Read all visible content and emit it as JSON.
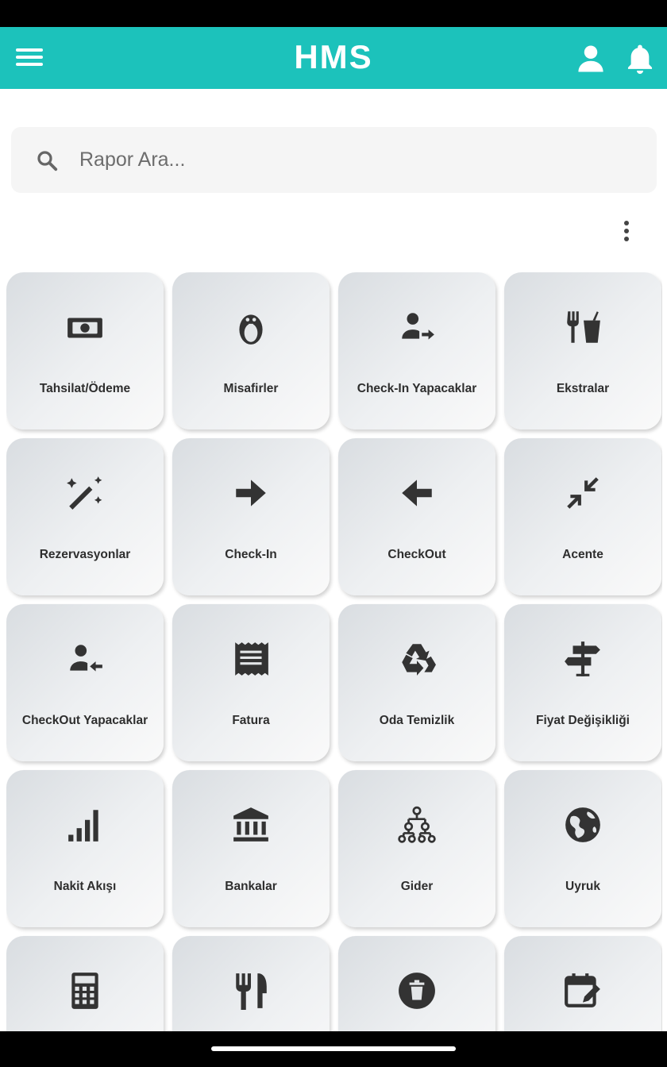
{
  "app": {
    "title": "HMS",
    "brand_color": "#1cc2bb"
  },
  "header": {
    "menu_icon": "hamburger-menu-icon",
    "user_icon": "person-icon",
    "bell_icon": "notifications-bell-icon"
  },
  "search": {
    "placeholder": "Rapor Ara...",
    "value": "",
    "icon": "search-icon"
  },
  "options_icon": "more-vert-icon",
  "tiles": [
    {
      "label": "Tahsilat/Ödeme",
      "icon": "money-bill-icon"
    },
    {
      "label": "Misafirler",
      "icon": "penguin-icon"
    },
    {
      "label": "Check-In Yapacaklar",
      "icon": "person-arrow-right-icon"
    },
    {
      "label": "Ekstralar",
      "icon": "fork-drink-icon"
    },
    {
      "label": "Rezervasyonlar",
      "icon": "magic-wand-icon"
    },
    {
      "label": "Check-In",
      "icon": "arrow-right-icon"
    },
    {
      "label": "CheckOut",
      "icon": "arrow-left-icon"
    },
    {
      "label": "Acente",
      "icon": "compress-arrows-icon"
    },
    {
      "label": "CheckOut Yapacaklar",
      "icon": "person-arrow-left-icon"
    },
    {
      "label": "Fatura",
      "icon": "receipt-icon"
    },
    {
      "label": "Oda Temizlik",
      "icon": "recycle-icon"
    },
    {
      "label": "Fiyat Değişikliği",
      "icon": "signpost-icon"
    },
    {
      "label": "Nakit Akışı",
      "icon": "signal-bars-icon"
    },
    {
      "label": "Bankalar",
      "icon": "bank-icon"
    },
    {
      "label": "Gider",
      "icon": "hierarchy-icon"
    },
    {
      "label": "Uyruk",
      "icon": "globe-icon"
    },
    {
      "label": "",
      "icon": "calculator-icon"
    },
    {
      "label": "",
      "icon": "restaurant-icon"
    },
    {
      "label": "",
      "icon": "trash-circle-icon"
    },
    {
      "label": "",
      "icon": "calendar-edit-icon"
    }
  ]
}
